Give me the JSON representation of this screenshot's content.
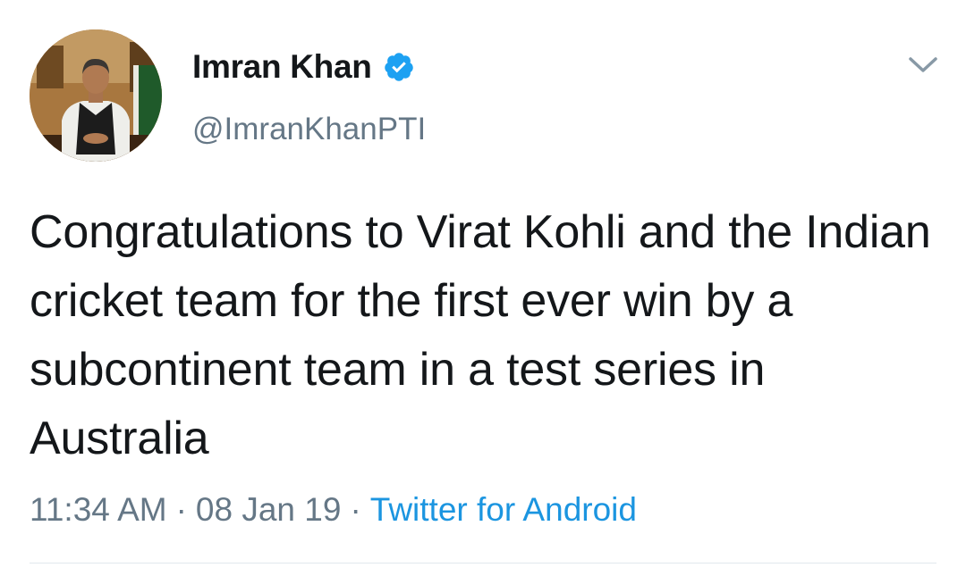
{
  "user": {
    "display_name": "Imran Khan",
    "handle": "@ImranKhanPTI",
    "verified": true,
    "avatar_icon": "profile-photo"
  },
  "tweet": {
    "text": "Congratulations to Virat Kohli and the Indian cricket team for the first ever win by a subcontinent team in a test series in Australia",
    "time": "11:34 AM",
    "date": "08 Jan 19",
    "separator": "·",
    "source": "Twitter for Android"
  },
  "colors": {
    "text": "#14171a",
    "secondary": "#657786",
    "link": "#1b95e0",
    "verified_badge": "#1da1f2",
    "divider": "#e1e8ed"
  },
  "icons": {
    "verified": "verified-badge-icon",
    "menu": "chevron-down-icon"
  }
}
